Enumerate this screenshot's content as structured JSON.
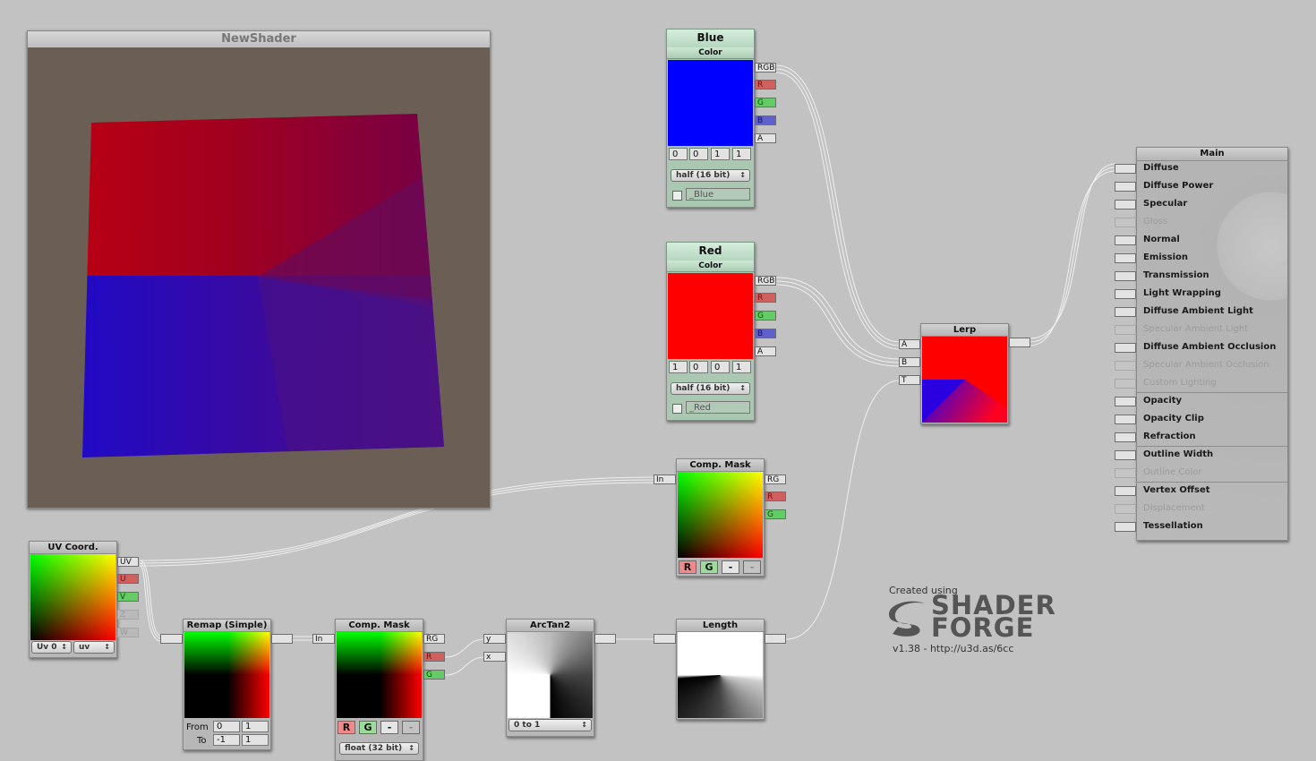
{
  "preview": {
    "title": "NewShader"
  },
  "blue_node": {
    "name": "Blue",
    "type": "Color",
    "values": [
      "0",
      "0",
      "1",
      "1"
    ],
    "precision": "half (16 bit)",
    "property_name": "_Blue",
    "color": "#0000ff"
  },
  "red_node": {
    "name": "Red",
    "type": "Color",
    "values": [
      "1",
      "0",
      "0",
      "1"
    ],
    "precision": "half (16 bit)",
    "property_name": "_Red",
    "color": "#ff0000"
  },
  "color_ports": {
    "rgb": "RGB",
    "r": "R",
    "g": "G",
    "b": "B",
    "a": "A"
  },
  "lerp_node": {
    "title": "Lerp",
    "inputs": {
      "a": "A",
      "b": "B",
      "t": "T"
    }
  },
  "comp_mask_top": {
    "title": "Comp. Mask",
    "input": "In",
    "outputs": {
      "rg": "RG",
      "r": "R",
      "g": "G"
    },
    "buttons": {
      "r": "R",
      "g": "G",
      "x": "-",
      "y": "-"
    }
  },
  "uv_node": {
    "title": "UV Coord.",
    "outputs": {
      "uv": "UV",
      "u": "U",
      "v": "V",
      "z": "Z",
      "w": "W"
    },
    "channel": "Uv 0",
    "mode": "uv"
  },
  "remap_node": {
    "title": "Remap (Simple)",
    "from_label": "From",
    "to_label": "To",
    "from": [
      "0",
      "1"
    ],
    "to": [
      "-1",
      "1"
    ]
  },
  "comp_mask_bottom": {
    "title": "Comp. Mask",
    "input": "In",
    "outputs": {
      "rg": "RG",
      "r": "R",
      "g": "G"
    },
    "buttons": {
      "r": "R",
      "g": "G",
      "x": "-",
      "y": "-"
    },
    "precision": "float (32 bit)"
  },
  "arctan_node": {
    "title": "ArcTan2",
    "inputs": {
      "y": "y",
      "x": "x"
    },
    "mode": "0 to 1"
  },
  "length_node": {
    "title": "Length"
  },
  "main_node": {
    "title": "Main",
    "inputs": [
      {
        "label": "Diffuse",
        "enabled": true
      },
      {
        "label": "Diffuse Power",
        "enabled": true
      },
      {
        "label": "Specular",
        "enabled": true
      },
      {
        "label": "Gloss",
        "enabled": false
      },
      {
        "label": "Normal",
        "enabled": true
      },
      {
        "label": "Emission",
        "enabled": true
      },
      {
        "label": "Transmission",
        "enabled": true
      },
      {
        "label": "Light Wrapping",
        "enabled": true
      },
      {
        "label": "Diffuse Ambient Light",
        "enabled": true
      },
      {
        "label": "Specular Ambient Light",
        "enabled": false
      },
      {
        "label": "Diffuse Ambient Occlusion",
        "enabled": true
      },
      {
        "label": "Specular Ambient Occlusion",
        "enabled": false
      },
      {
        "label": "Custom Lighting",
        "enabled": false
      },
      {
        "label": "Opacity",
        "enabled": true
      },
      {
        "label": "Opacity Clip",
        "enabled": true
      },
      {
        "label": "Refraction",
        "enabled": true
      },
      {
        "label": "Outline Width",
        "enabled": true
      },
      {
        "label": "Outline Color",
        "enabled": false
      },
      {
        "label": "Vertex Offset",
        "enabled": true
      },
      {
        "label": "Displacement",
        "enabled": false
      },
      {
        "label": "Tessellation",
        "enabled": true
      }
    ]
  },
  "branding": {
    "created_using": "Created using",
    "brand_line1": "SHADER",
    "brand_line2": "FORGE",
    "version": "v1.38 - http://u3d.as/6cc"
  }
}
